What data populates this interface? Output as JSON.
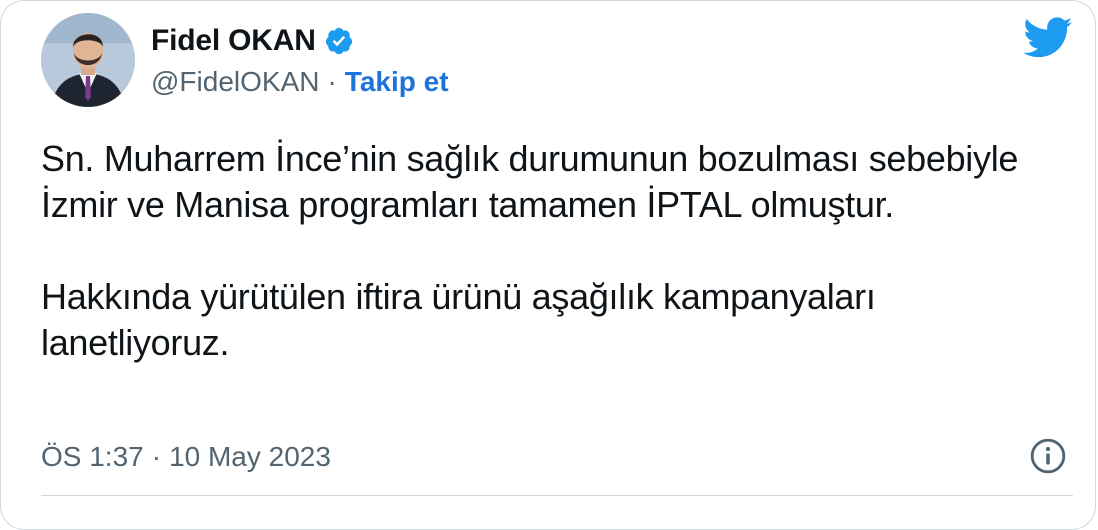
{
  "author": {
    "name": "Fidel OKAN",
    "handle": "@FidelOKAN",
    "separator": "·",
    "follow_label": "Takip et",
    "verified": true,
    "avatar_icon": "profile-photo",
    "verified_icon": "verified-badge-icon"
  },
  "brand": {
    "logo_icon": "twitter-bird-icon",
    "accent_color": "#1d9bf0",
    "link_color": "#1d73d8"
  },
  "tweet": {
    "paragraphs": [
      "Sn. Muharrem İnce’nin sağlık durumunun bozulması sebebiyle İzmir ve Manisa programları tamamen İPTAL olmuştur.",
      "Hakkında yürütülen iftira ürünü aşağılık kampanyaları lanetliyoruz."
    ]
  },
  "meta": {
    "time": "ÖS 1:37",
    "separator": "·",
    "date": "10 May 2023",
    "info_icon": "info-icon"
  }
}
